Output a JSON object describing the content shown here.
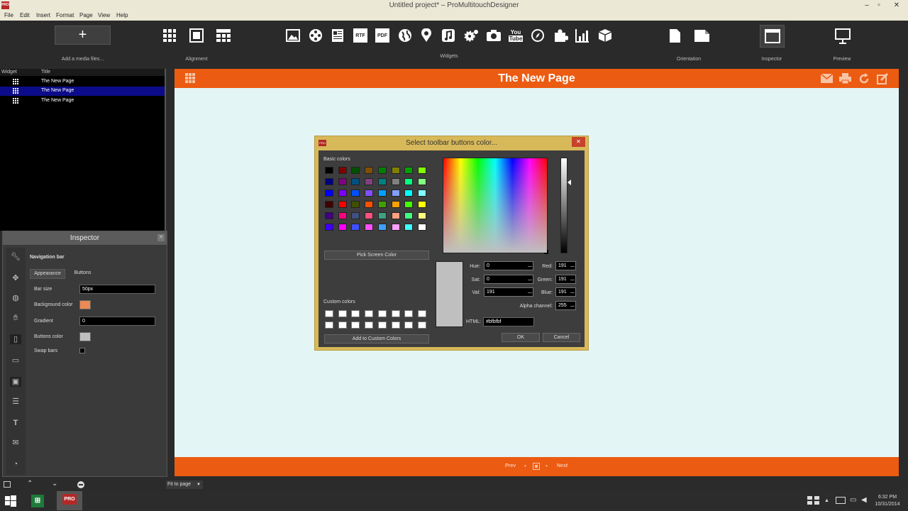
{
  "window": {
    "title": "Untitled project* – ProMultitouchDesigner",
    "logo": "PRO"
  },
  "menu": [
    "File",
    "Edit",
    "Insert",
    "Format",
    "Page",
    "View",
    "Help"
  ],
  "toolbar": {
    "add_media": "Add a media files...",
    "alignment": "Alignment",
    "widgets": "Widgets",
    "orientation": "Orientation",
    "inspector": "Inspector",
    "preview": "Preview"
  },
  "list": {
    "col_widget": "Widget",
    "col_title": "Title",
    "rows": [
      {
        "title": "The New Page"
      },
      {
        "title": "The New Page"
      },
      {
        "title": "The New Page"
      }
    ]
  },
  "inspector": {
    "title": "Inspector",
    "section": "Navigation bar",
    "tab_appearance": "Appearance",
    "tab_buttons": "Buttons",
    "bar_size_label": "Bar size",
    "bar_size": "50px",
    "bg_color_label": "Background color",
    "gradient_label": "Gradient",
    "gradient": "0",
    "buttons_color_label": "Buttons color",
    "swap_bars_label": "Swap bars"
  },
  "page": {
    "title": "The New Page",
    "prev": "Prev",
    "next": "Next"
  },
  "dialog": {
    "title": "Select toolbar buttons color...",
    "basic_colors": "Basic colors",
    "pick_screen": "Pick Screen Color",
    "custom_colors": "Custom colors",
    "add_custom": "Add to Custom Colors",
    "hue_label": "Hue:",
    "hue": "0",
    "sat_label": "Sat:",
    "sat": "0",
    "val_label": "Val:",
    "val": "191",
    "red_label": "Red:",
    "red": "191",
    "green_label": "Green:",
    "green": "191",
    "blue_label": "Blue:",
    "blue": "191",
    "alpha_label": "Alpha channel:",
    "alpha": "255",
    "html_label": "HTML:",
    "html": "#bfbfbf",
    "ok": "OK",
    "cancel": "Cancel"
  },
  "status": {
    "zoom": "Fit to page"
  },
  "clock": {
    "time": "6:32 PM",
    "date": "10/31/2014"
  },
  "colors": {
    "accent": "#ec5b12",
    "canvas": "#e3f5f5",
    "dialog": "#d8b95a",
    "bg_swatch": "#ec8a54",
    "current": "#bfbfbf"
  }
}
